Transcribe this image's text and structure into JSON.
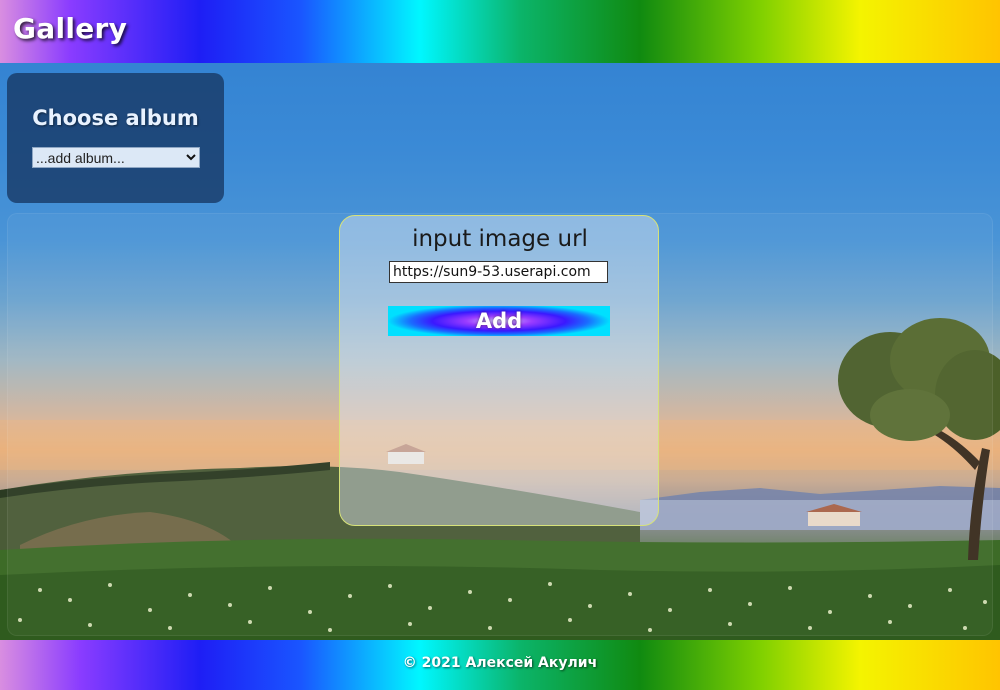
{
  "header": {
    "brand": "Gallery"
  },
  "album_panel": {
    "title": "Choose album",
    "select": {
      "selected": "...add album...",
      "options": [
        "...add album..."
      ]
    }
  },
  "upload_card": {
    "label": "input image url",
    "url_value": "https://sun9-53.userapi.com",
    "add_button": "Add"
  },
  "footer": {
    "copyright": "© 2021 Алексей Акулич"
  },
  "icons": {
    "select_chevron": "chevron-down-icon"
  },
  "colors": {
    "album_panel_bg": "#183a68",
    "card_border": "#d7e27a",
    "add_button_center": "#9a3cff",
    "add_button_edge": "#00e0ff"
  }
}
